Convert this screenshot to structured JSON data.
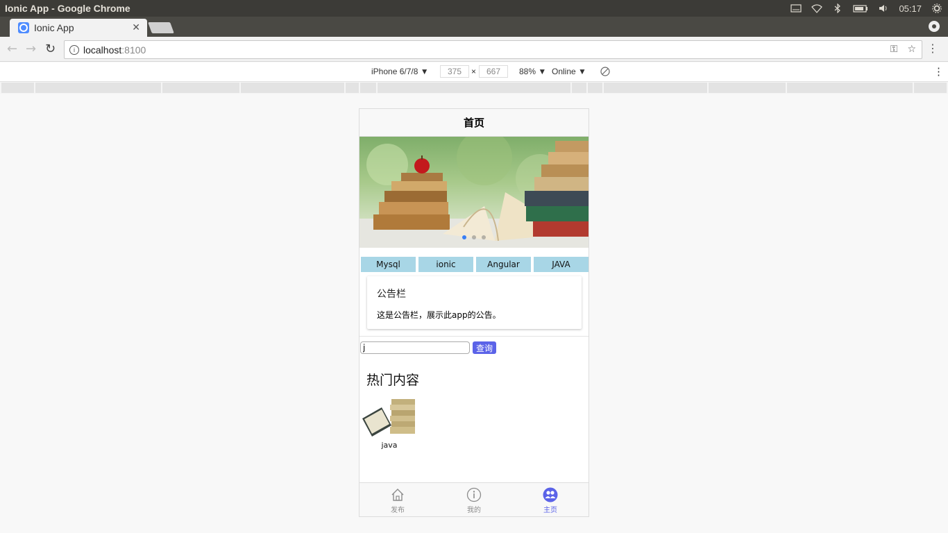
{
  "os": {
    "window_title": "Ionic App - Google Chrome",
    "time": "05:17"
  },
  "browser": {
    "tab_title": "Ionic App",
    "url_host": "localhost",
    "url_port": ":8100"
  },
  "devtools": {
    "device": "iPhone 6/7/8",
    "width": "375",
    "times": "×",
    "height": "667",
    "zoom": "88%",
    "network": "Online"
  },
  "app": {
    "header_title": "首页",
    "carousel": {
      "slides": 3,
      "active_index": 0
    },
    "categories": [
      "Mysql",
      "ionic",
      "Angular",
      "JAVA"
    ],
    "notice": {
      "title": "公告栏",
      "text": "这是公告栏，展示此app的公告。"
    },
    "search": {
      "value": "j",
      "button_label": "查询"
    },
    "hot": {
      "title": "热门内容",
      "items": [
        {
          "label": "java"
        }
      ]
    },
    "tabs": [
      {
        "label": "发布",
        "icon": "home-icon",
        "active": false
      },
      {
        "label": "我的",
        "icon": "info-icon",
        "active": false
      },
      {
        "label": "主页",
        "icon": "people-icon",
        "active": true
      }
    ]
  },
  "colors": {
    "accent": "#5b63e8",
    "category_bg": "#a8d6e6",
    "pager_active": "#387ef5"
  }
}
